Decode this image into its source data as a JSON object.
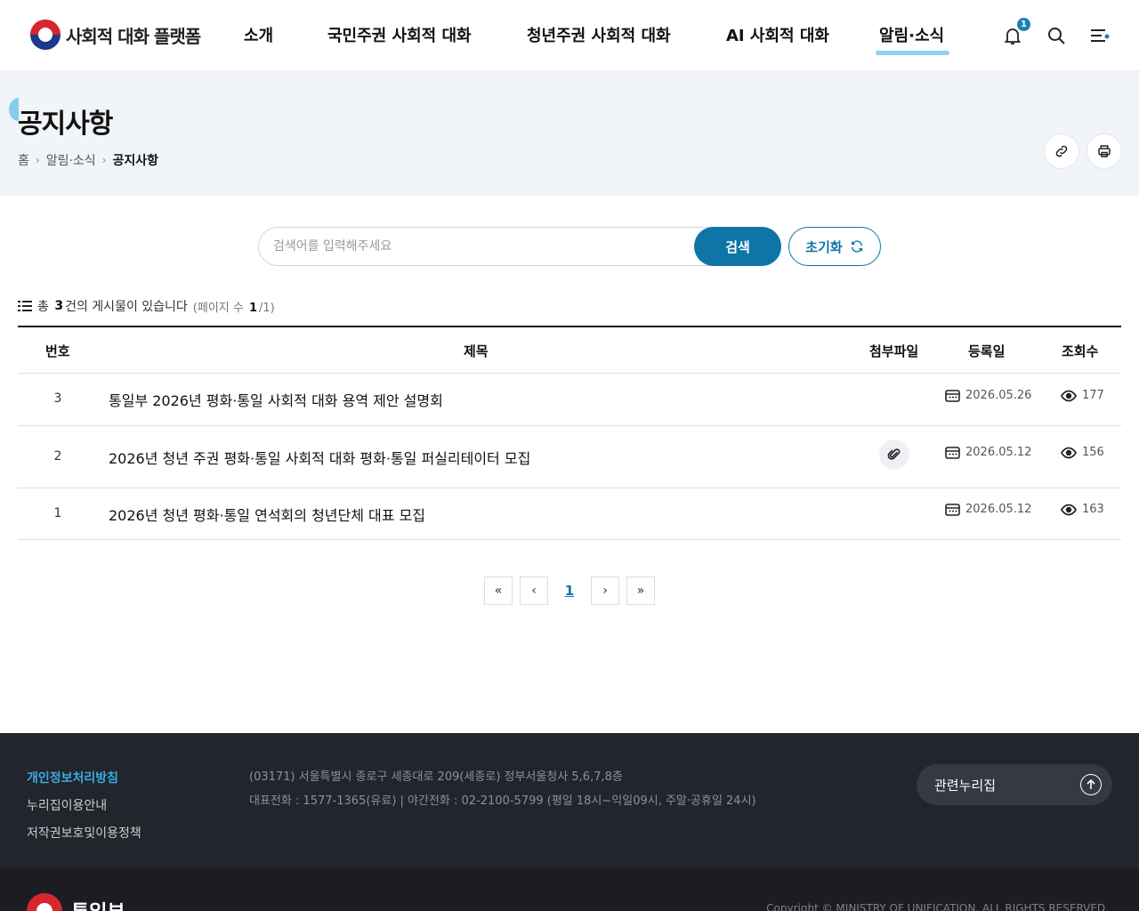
{
  "header": {
    "logo_text": "사회적 대화 플랫폼",
    "nav": [
      {
        "label": "소개"
      },
      {
        "label": "국민주권 사회적 대화"
      },
      {
        "label": "청년주권 사회적 대화"
      },
      {
        "label": "AI 사회적 대화"
      },
      {
        "label": "알림·소식",
        "active": true
      }
    ],
    "notification_count": "1",
    "icons": [
      "bell-icon",
      "search-icon",
      "menu-icon"
    ]
  },
  "page": {
    "title": "공지사항",
    "breadcrumb": [
      "홈",
      "알림·소식",
      "공지사항"
    ],
    "actions": [
      "link-icon",
      "print-icon"
    ]
  },
  "search": {
    "placeholder": "검색어를 입력해주세요",
    "value": "",
    "search_label": "검색",
    "reset_label": "초기화"
  },
  "summary": {
    "prefix": "총",
    "total": "3",
    "suffix": "건의 게시물이 있습니다",
    "page_prefix": "(페이지 수",
    "page_current": "1",
    "page_total": "/1)"
  },
  "table": {
    "columns": [
      "번호",
      "제목",
      "첨부파일",
      "등록일",
      "조회수"
    ],
    "rows": [
      {
        "num": "3",
        "title": "통일부 2026년 평화·통일 사회적 대화 용역 제안 설명회",
        "attachment": false,
        "date": "2026.05.26",
        "views": "177"
      },
      {
        "num": "2",
        "title": "2026년 청년 주권 평화·통일 사회적 대화 평화·통일 퍼실리테이터 모집",
        "attachment": true,
        "date": "2026.05.12",
        "views": "156"
      },
      {
        "num": "1",
        "title": "2026년 청년 평화·통일 연석회의 청년단체 대표 모집",
        "attachment": false,
        "date": "2026.05.12",
        "views": "163"
      }
    ]
  },
  "pagination": {
    "current": "1"
  },
  "footer": {
    "links": [
      {
        "label": "개인정보처리방침",
        "highlight": true
      },
      {
        "label": "누리집이용안내"
      },
      {
        "label": "저작권보호및이용정책"
      }
    ],
    "address": "(03171) 서울특별시 종로구 세종대로 209(세종로) 정부서울청사 5,6,7,8층",
    "phone": "대표전화 : 1577-1365(유료)  |  야간전화 : 02-2100-5799 (평일 18시~익일09시, 주말·공휴일 24시)",
    "related_label": "관련누리집",
    "org_name": "통일부",
    "copyright": "Copyright © MINISTRY OF UNIFICATION. ALL RIGHTS RESERVED."
  },
  "colors": {
    "accent": "#0f75a8",
    "highlight": "#8fd3ee",
    "footer_bg": "#22252b"
  }
}
